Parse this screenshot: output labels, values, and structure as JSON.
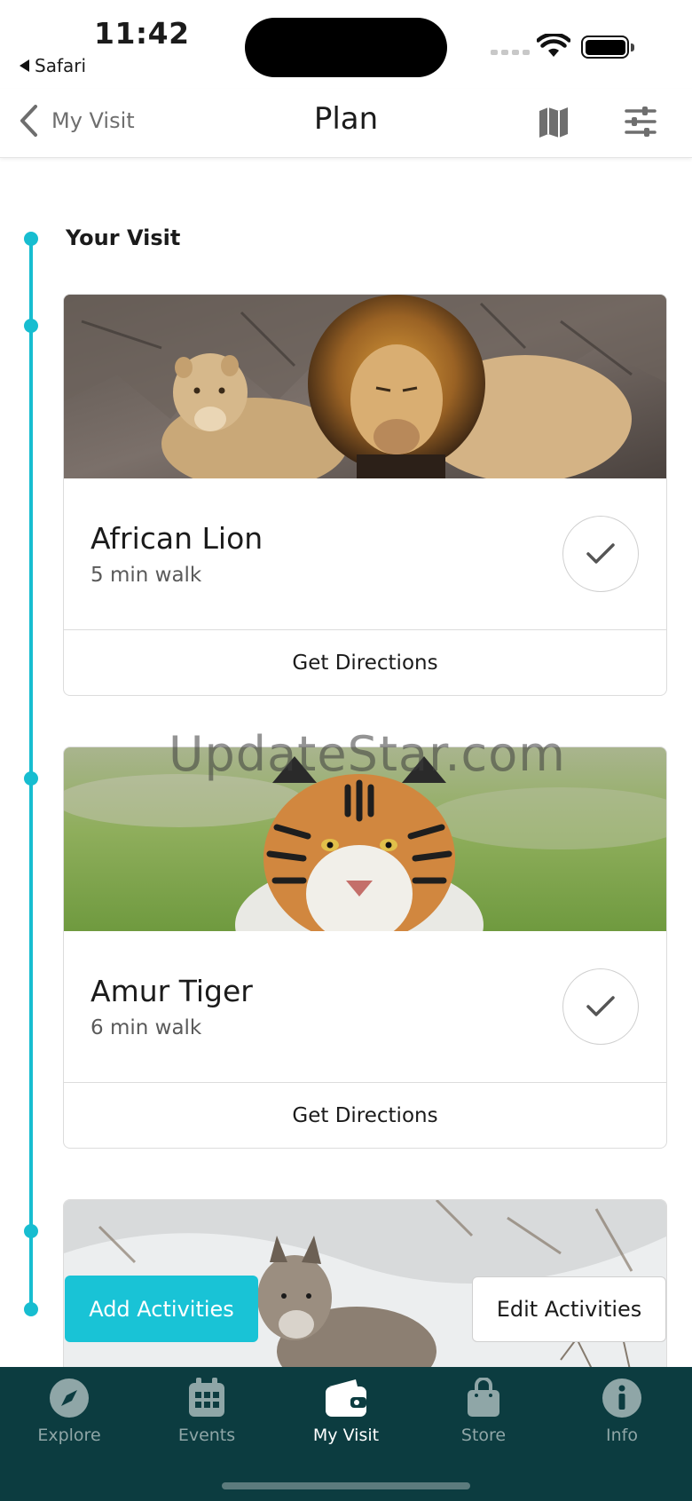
{
  "status_bar": {
    "time": "11:42",
    "back_app": "Safari"
  },
  "nav": {
    "back_label": "My Visit",
    "title": "Plan",
    "map_icon": "map-icon",
    "filter_icon": "sliders-icon"
  },
  "section": {
    "title": "Your Visit"
  },
  "cards": [
    {
      "name": "African Lion",
      "walk": "5 min walk",
      "directions_label": "Get Directions",
      "completed": true,
      "photo": "lions-photo"
    },
    {
      "name": "Amur Tiger",
      "walk": "6 min walk",
      "directions_label": "Get Directions",
      "completed": true,
      "photo": "tiger-photo"
    },
    {
      "photo": "wolf-photo"
    }
  ],
  "watermark": "UpdateStar.com",
  "actions": {
    "add_label": "Add Activities",
    "edit_label": "Edit Activities"
  },
  "tabbar": {
    "tabs": [
      {
        "label": "Explore",
        "icon": "compass-icon",
        "active": false
      },
      {
        "label": "Events",
        "icon": "calendar-icon",
        "active": false
      },
      {
        "label": "My Visit",
        "icon": "wallet-icon",
        "active": true
      },
      {
        "label": "Store",
        "icon": "shopping-bag-icon",
        "active": false
      },
      {
        "label": "Info",
        "icon": "info-icon",
        "active": false
      }
    ]
  },
  "colors": {
    "accent": "#17bdd0",
    "tabbar": "#0c3c40",
    "tab_inactive": "#8fa6a7",
    "tab_active": "#ffffff"
  }
}
